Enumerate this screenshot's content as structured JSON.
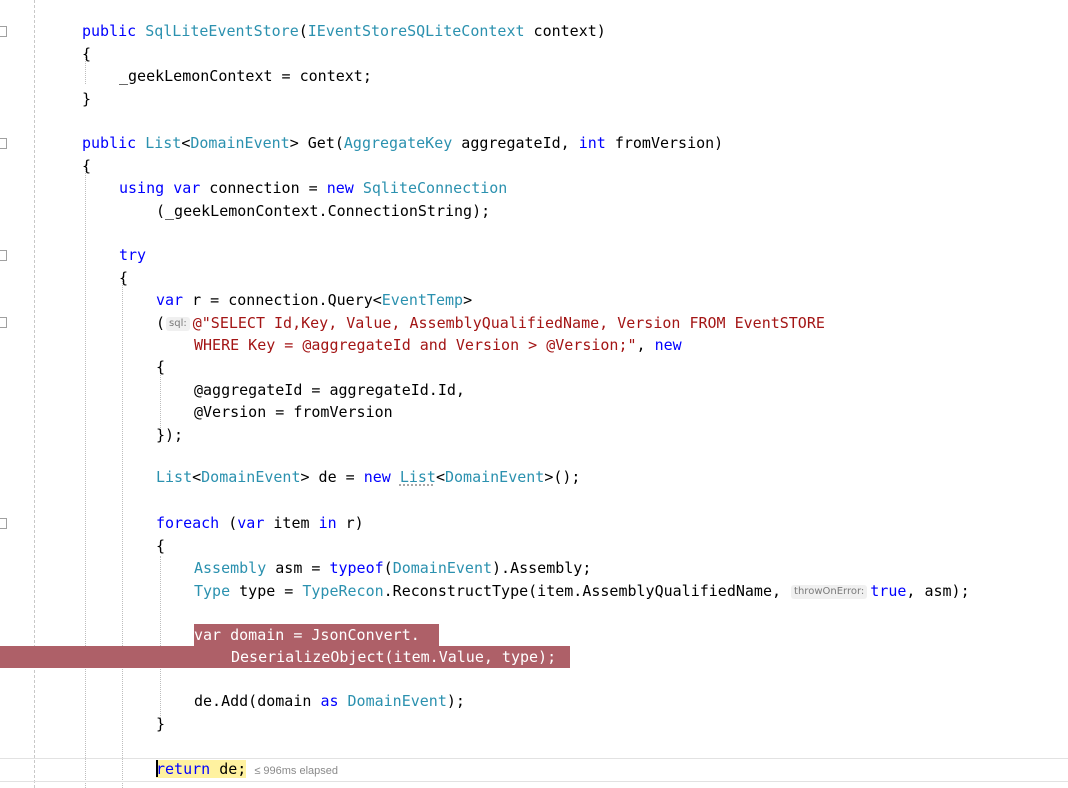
{
  "colors": {
    "keyword": "#0000ff",
    "type": "#2b91af",
    "string": "#a31515",
    "breakpoint": "#ae6068",
    "current_statement": "#fff2a0"
  },
  "code": {
    "l1": {
      "kw": "public",
      "type": "SqlLiteEventStore",
      "open": "(",
      "ptype": "IEventStoreSQLiteContext",
      "rest": " context)"
    },
    "l2": "{",
    "l3": "_geekLemonContext = context;",
    "l4": "}",
    "l6": {
      "kw": "public",
      "t1": "List",
      "lt": "<",
      "t2": "DomainEvent",
      "mid": "> Get(",
      "t3": "AggregateKey",
      "p1": " aggregateId, ",
      "kw2": "int",
      "p2": " fromVersion)"
    },
    "l7": "{",
    "l8": {
      "kw1": "using",
      "kw2": "var",
      "mid": " connection = ",
      "kw3": "new",
      "type": "SqliteConnection"
    },
    "l9": "(_geekLemonContext.ConnectionString);",
    "l11": "try",
    "l12": "{",
    "l13": {
      "kw": "var",
      "mid": " r = connection.Query<",
      "type": "EventTemp",
      "end": ">"
    },
    "l14": {
      "open": "(",
      "hint": "sql:",
      "str": "@\"SELECT Id,Key, Value, AssemblyQualifiedName, Version FROM EventSTORE"
    },
    "l15": {
      "str": "WHERE Key = @aggregateId and Version > @Version;\"",
      "sep": ", ",
      "kw": "new"
    },
    "l16": "{",
    "l17": "@aggregateId = aggregateId.Id,",
    "l18": "@Version = fromVersion",
    "l19": "});",
    "l21": {
      "t1": "List",
      "lt": "<",
      "t2": "DomainEvent",
      "mid": "> de = ",
      "kw": "new",
      "t3": "List",
      "lt2": "<",
      "t4": "DomainEvent",
      "end": ">();"
    },
    "l23": {
      "kw1": "foreach",
      "open": " (",
      "kw2": "var",
      "mid": " item ",
      "kw3": "in",
      "end": " r)"
    },
    "l24": "{",
    "l25": {
      "type": "Assembly",
      "mid": " asm = ",
      "kw": "typeof",
      "open": "(",
      "type2": "DomainEvent",
      "end": ").Assembly;"
    },
    "l26": {
      "type": "Type",
      "mid": " type = ",
      "type2": "TypeRecon",
      "call": ".ReconstructType(item.AssemblyQualifiedName, ",
      "hint": "throwOnError:",
      "kw": "true",
      "end": ", asm);"
    },
    "l28": "var domain = JsonConvert.",
    "l29": "DeserializeObject(item.Value, type);",
    "l31": {
      "pre": "de.Add(domain ",
      "kw": "as",
      "type": "DomainEvent",
      "end": ");"
    },
    "l32": "}",
    "l34": {
      "kw": "return",
      "rest": " de;"
    },
    "perf_tip": "≤ 996ms elapsed"
  }
}
